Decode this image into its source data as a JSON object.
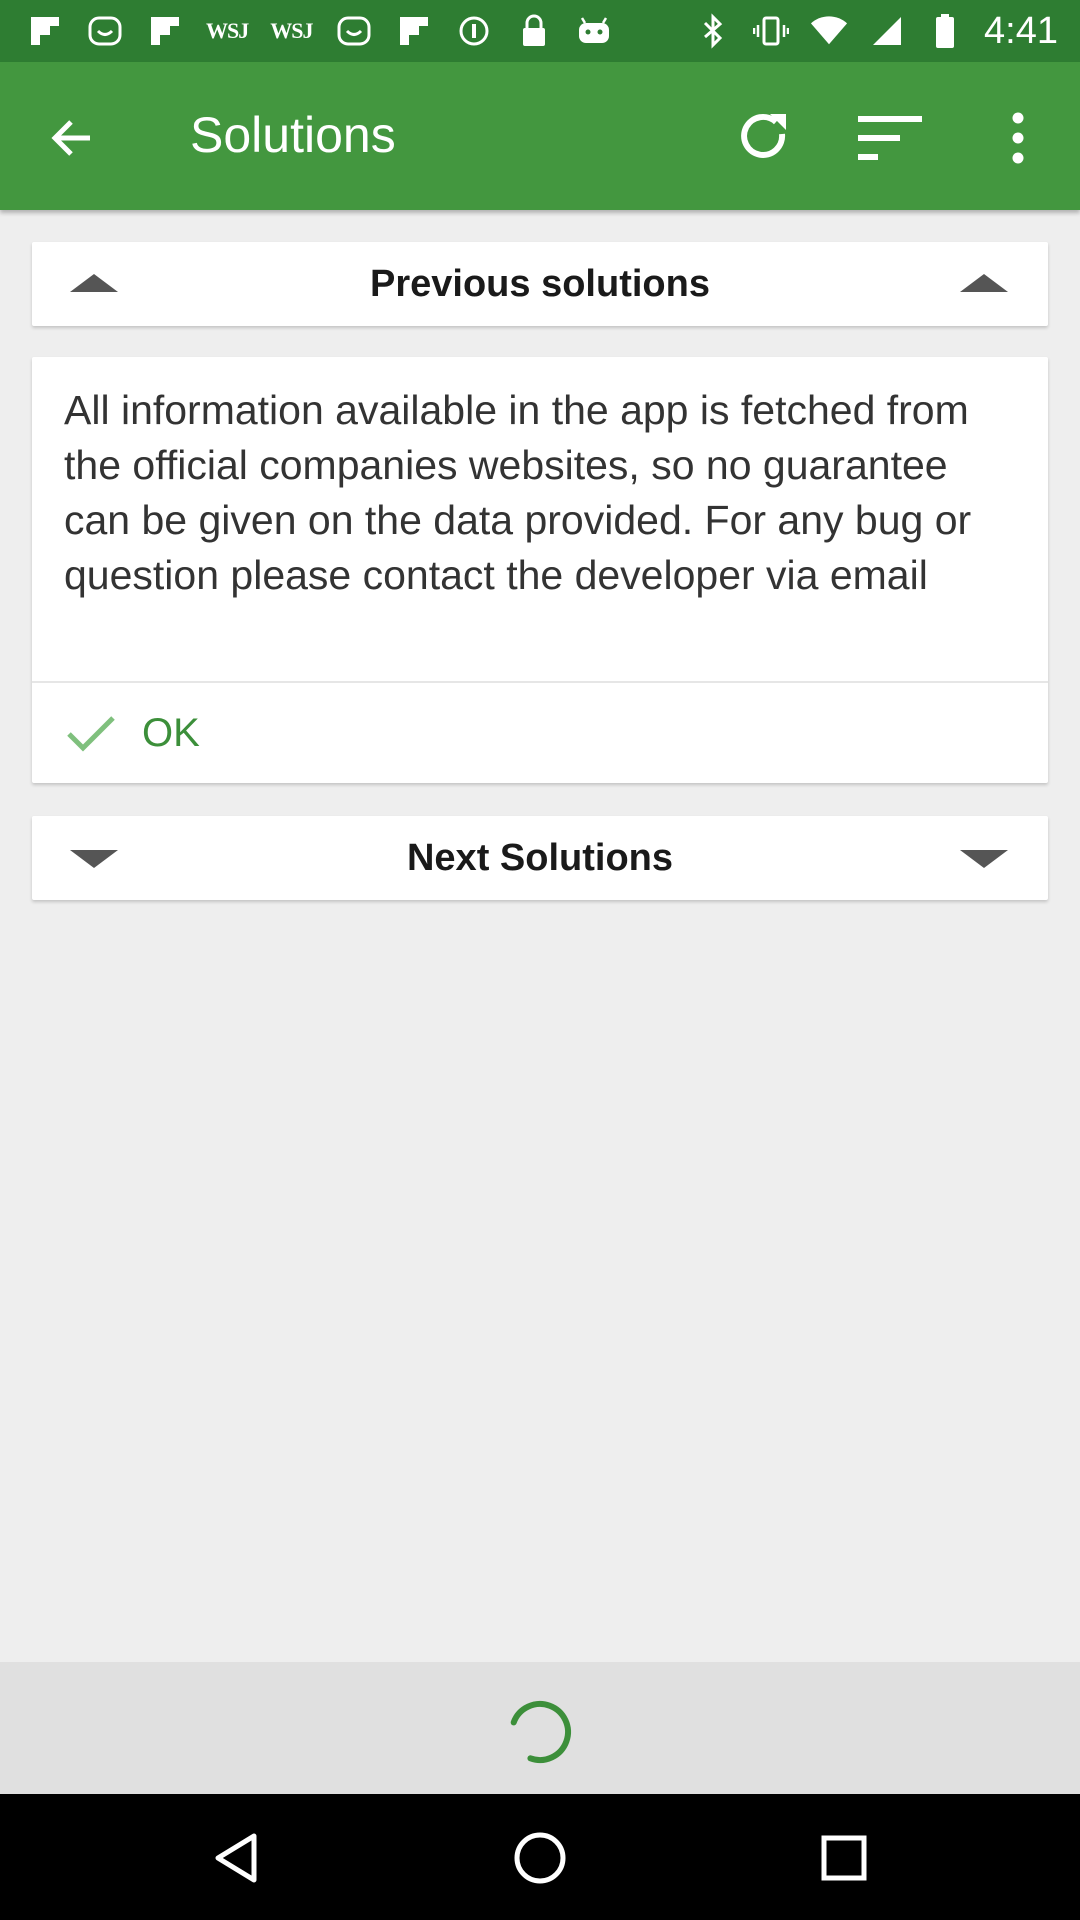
{
  "status_bar": {
    "notifications": [
      "flipboard-icon",
      "smiley-icon",
      "flipboard-icon",
      "WSJ",
      "WSJ",
      "smiley-icon",
      "flipboard-icon",
      "info-icon",
      "lock-icon",
      "android-icon"
    ],
    "wsj_1": "WSJ",
    "wsj_2": "WSJ",
    "time": "4:41"
  },
  "app_bar": {
    "title": "Solutions",
    "background": "#43973f"
  },
  "previous_toggle": {
    "label": "Previous solutions"
  },
  "info": {
    "text": "All information available in the app is fetched from the official companies websites, so no guarantee can be given on the data provided. For any bug or question please contact the developer via email",
    "ok_label": "OK"
  },
  "next_toggle": {
    "label": "Next Solutions"
  },
  "colors": {
    "accent": "#3c8f3a",
    "status_bar": "#2e7d32",
    "background": "#eeeeee"
  }
}
